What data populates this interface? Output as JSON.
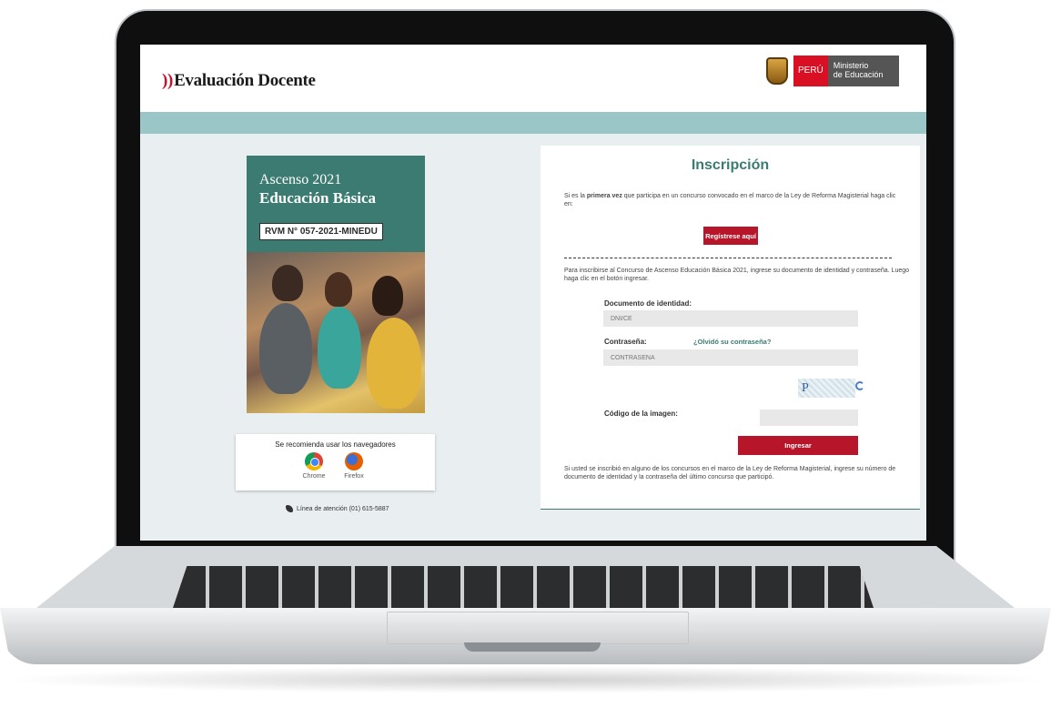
{
  "header": {
    "brand_mark": "))",
    "brand_text": "Evaluación Docente",
    "gov_badge": {
      "peru": "PERÚ",
      "ministry_line1": "Ministerio",
      "ministry_line2": "de Educación"
    }
  },
  "poster": {
    "title_line1": "Ascenso 2021",
    "title_line2": "Educación Básica",
    "rvm": "RVM N° 057-2021-MINEDU"
  },
  "browsers": {
    "caption": "Se recomienda usar los navegadores",
    "chrome": "Chrome",
    "firefox": "Firefox"
  },
  "support_line": "Línea de atención (01) 615-5887",
  "form": {
    "title": "Inscripción",
    "first_time_prefix": "Si es la ",
    "first_time_bold": "primera vez",
    "first_time_suffix": " que participa en un concurso convocado en el marco de la Ley de Reforma Magisterial haga clic en:",
    "register_button": "Regístrese aquí",
    "instructions": "Para inscribirse al Concurso de Ascenso Educación Básica 2021, ingrese su documento de identidad y contraseña. Luego haga clic en el botón ingresar.",
    "doc_label": "Documento de identidad:",
    "doc_placeholder": "DNI/CE",
    "password_label": "Contraseña:",
    "forgot_link": "¿Olvidó su contraseña?",
    "password_placeholder": "CONTRASEÑA",
    "captcha_text": "P",
    "captcha_label": "Código de la imagen:",
    "submit_button": "Ingresar",
    "footer_note": "Si usted se inscribió en alguno de los concursos en el marco de la Ley de Reforma Magisterial, ingrese su número de documento de identidad y la contraseña del último concurso que participó."
  },
  "colors": {
    "accent": "#3b7b72",
    "button": "#b7152a",
    "band": "#9ac6c8"
  }
}
